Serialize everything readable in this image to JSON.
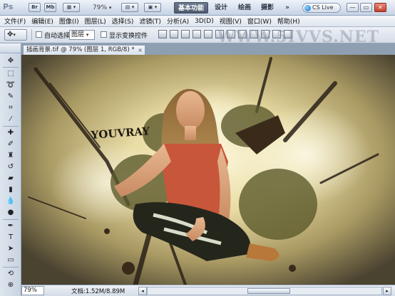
{
  "app": {
    "logo": "Ps",
    "bridge_label": "Br",
    "minibridge_label": "Mb",
    "zoom": "79%",
    "workspaces": [
      "基本功能",
      "设计",
      "绘画",
      "摄影"
    ],
    "more": "»",
    "cs_live": "CS Live",
    "window_buttons": [
      "—",
      "▭",
      "✕"
    ]
  },
  "menu": {
    "items": [
      "文件(F)",
      "编辑(E)",
      "图像(I)",
      "图层(L)",
      "选择(S)",
      "滤镜(T)",
      "分析(A)",
      "3D(D)",
      "视图(V)",
      "窗口(W)",
      "帮助(H)"
    ]
  },
  "options": {
    "auto_select_label": "自动选择:",
    "auto_select_value": "图层",
    "show_transform_label": "显示变换控件",
    "watermark": "WWW.5IVVS.NET"
  },
  "document": {
    "tab_title": "插画背景.tif @ 79% (图层 1, RGB/8) *",
    "tab_close": "×",
    "canvas_text": "YOUVRAY"
  },
  "status": {
    "zoom": "79%",
    "doc_info": "文档:1.52M/8.89M",
    "arrow": "▶"
  },
  "colors": {
    "workspace_active": "#5a677c",
    "canvas_glow": "#f8f2c8",
    "shirt": "#c8563a"
  },
  "tools": [
    "move-tool",
    "marquee-tool",
    "lasso-tool",
    "quick-select-tool",
    "crop-tool",
    "eyedropper-tool",
    "healing-brush-tool",
    "brush-tool",
    "clone-stamp-tool",
    "history-brush-tool",
    "eraser-tool",
    "gradient-tool",
    "blur-tool",
    "dodge-tool",
    "pen-tool",
    "type-tool",
    "path-select-tool",
    "shape-tool",
    "3d-rotate-tool",
    "3d-orbit-tool"
  ]
}
